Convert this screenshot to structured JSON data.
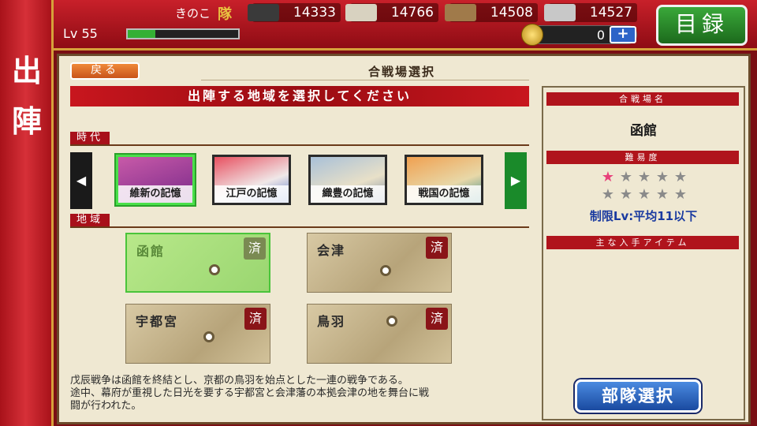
{
  "header": {
    "player_name": "きのこ",
    "clan_mark": "隊",
    "level": "Lv 55",
    "exp_fraction": 0.25,
    "resources": [
      {
        "icon": "iron-icon",
        "value": "14333",
        "color": "#3a3a3a"
      },
      {
        "icon": "rice-icon",
        "value": "14766",
        "color": "#d8d2c0"
      },
      {
        "icon": "wood-icon",
        "value": "14508",
        "color": "#a07a4a"
      },
      {
        "icon": "steel-icon",
        "value": "14527",
        "color": "#c8c8c8"
      }
    ],
    "coins": "0",
    "coin_plus": "+",
    "menu_button": "目録"
  },
  "ribbon": {
    "label": "出陣"
  },
  "main": {
    "back_button": "戻る",
    "screen_title": "合戦場選択",
    "instruction": "出陣する地域を選択してください",
    "era_section_label": "時代",
    "region_section_label": "地域",
    "eras": [
      {
        "label": "維新の記憶",
        "selected": true,
        "bg": "#9a4aa0"
      },
      {
        "label": "江戸の記憶",
        "selected": false,
        "bg": "#c8304a"
      },
      {
        "label": "織豊の記憶",
        "selected": false,
        "bg": "#8aa0b8"
      },
      {
        "label": "戦国の記憶",
        "selected": false,
        "bg": "#c86a2a"
      }
    ],
    "regions": [
      {
        "name": "函館",
        "badge": "済",
        "selected": true
      },
      {
        "name": "会津",
        "badge": "済",
        "selected": false
      },
      {
        "name": "宇都宮",
        "badge": "済",
        "selected": false
      },
      {
        "name": "鳥羽",
        "badge": "済",
        "selected": false
      }
    ],
    "description": [
      "戊辰戦争は函館を終結とし、京都の鳥羽を始点とした一連の戦争である。",
      "途中、幕府が重視した日光を要する宇都宮と会津藩の本拠会津の地を舞台に戦",
      "闘が行われた。"
    ]
  },
  "info": {
    "battlefield_header": "合戦場名",
    "battlefield_name": "函館",
    "difficulty_header": "難易度",
    "difficulty": 1,
    "difficulty_max": 10,
    "level_limit": "制限Lv:平均11以下",
    "items_header": "主な入手アイテム",
    "sortie_button": "部隊選択"
  }
}
